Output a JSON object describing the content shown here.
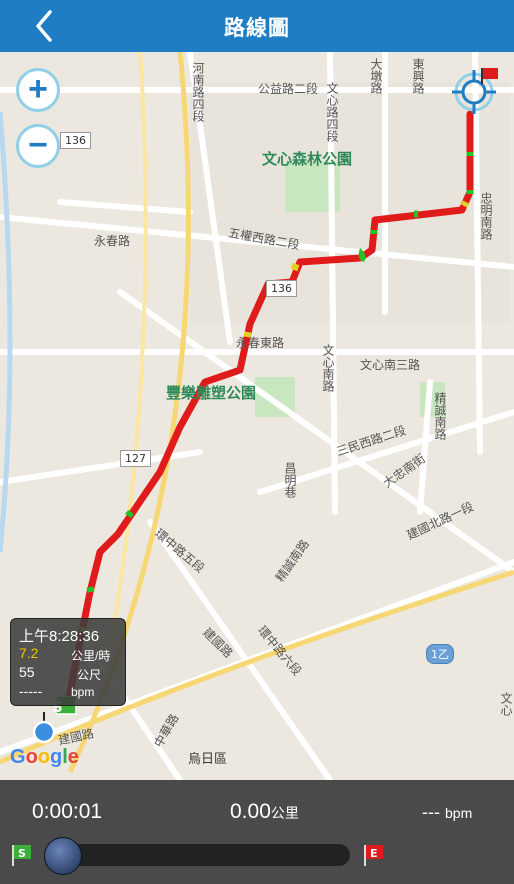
{
  "header": {
    "title": "路線圖"
  },
  "map": {
    "road_labels": [
      "河南路四段",
      "公益路二段",
      "文心路四段",
      "大墩路",
      "東興路",
      "五權西路二段",
      "永春路",
      "永春東路",
      "文心南三路",
      "文心南路",
      "三民西路二段",
      "精誠南路",
      "大忠南街",
      "精誠南路",
      "環中路五段",
      "環中路六段",
      "建國路",
      "建國北路一段",
      "中華路",
      "昌明巷",
      "建國路",
      "忠明南路",
      "文心"
    ],
    "area_labels": [
      "烏日區"
    ],
    "park_labels": [
      "文心森林公園",
      "豐樂雕塑公園"
    ],
    "route_shields": [
      "136",
      "136",
      "127",
      "1乙"
    ],
    "zoom_in": "+",
    "zoom_out": "−",
    "start_marker": "S",
    "attribution": "Google"
  },
  "info_popup": {
    "time": "上午8:28:36",
    "speed": "7.2",
    "speed_unit": "公里/時",
    "altitude": "55",
    "altitude_unit": "公尺",
    "heart_rate": "-----",
    "heart_rate_unit": "bpm"
  },
  "bottom_bar": {
    "elapsed": "0:00:01",
    "distance": "0.00",
    "distance_unit": "公里",
    "bpm_value": "---",
    "bpm_unit": "bpm",
    "start_flag": "S",
    "end_flag": "E",
    "progress": 0
  },
  "colors": {
    "header": "#1f7dc4",
    "route": "#e01b1b",
    "route_slow": "#22c322",
    "bottom_bar": "#4a4a4a"
  }
}
